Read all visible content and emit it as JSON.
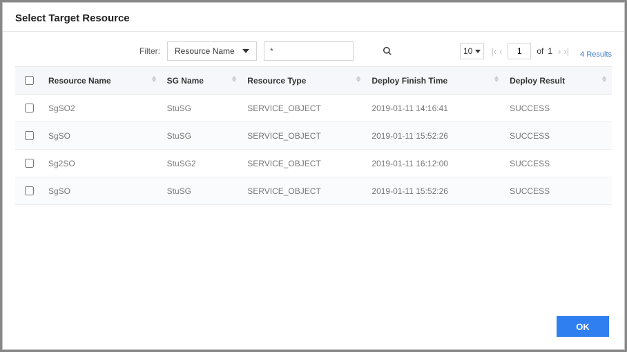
{
  "title": "Select Target Resource",
  "filter": {
    "label": "Filter:",
    "selected": "Resource Name",
    "search_value": "*"
  },
  "pager": {
    "page_size": "10",
    "current_page": "1",
    "of_label": "of",
    "total_pages": "1",
    "results_label": "4 Results"
  },
  "columns": {
    "resource_name": "Resource  Name",
    "sg_name": "SG  Name",
    "resource_type": "Resource  Type",
    "deploy_finish_time": "Deploy  Finish  Time",
    "deploy_result": "Deploy  Result"
  },
  "rows": [
    {
      "resource_name": "SgSO2",
      "sg_name": "StuSG",
      "resource_type": "SERVICE_OBJECT",
      "deploy_finish_time": "2019-01-11 14:16:41",
      "deploy_result": "SUCCESS"
    },
    {
      "resource_name": "SgSO",
      "sg_name": "StuSG",
      "resource_type": "SERVICE_OBJECT",
      "deploy_finish_time": "2019-01-11 15:52:26",
      "deploy_result": "SUCCESS"
    },
    {
      "resource_name": "Sg2SO",
      "sg_name": "StuSG2",
      "resource_type": "SERVICE_OBJECT",
      "deploy_finish_time": "2019-01-11 16:12:00",
      "deploy_result": "SUCCESS"
    },
    {
      "resource_name": "SgSO",
      "sg_name": "StuSG",
      "resource_type": "SERVICE_OBJECT",
      "deploy_finish_time": "2019-01-11 15:52:26",
      "deploy_result": "SUCCESS"
    }
  ],
  "buttons": {
    "ok": "OK"
  }
}
